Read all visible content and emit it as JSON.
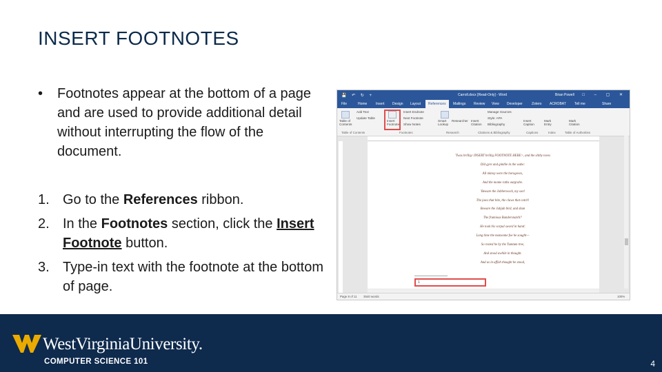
{
  "slide": {
    "title": "INSERT FOOTNOTES",
    "bullet": "Footnotes appear at the bottom of a page and are used to provide additional detail without interrupting the flow of the document.",
    "steps": [
      {
        "num": "1.",
        "pre": "Go to the ",
        "bold": "References",
        "post": " ribbon."
      },
      {
        "num": "2.",
        "pre": "In the ",
        "bold": "Footnotes",
        "mid": " section, click the ",
        "bold_underlined": "Insert Footnote",
        "post": " button."
      },
      {
        "num": "3.",
        "pre": "Type-in text with the footnote at the bottom of page."
      }
    ]
  },
  "footer": {
    "university": "WestVirginiaUniversity.",
    "course": "COMPUTER SCIENCE 101",
    "page_number": "4",
    "bg_color": "#0e2a4d",
    "logo_color": "#eaaa00"
  },
  "word": {
    "doc_title": "Carroll.docx [Read-Only] - Word",
    "user": "Brian Powell",
    "tabs": [
      "File",
      "Home",
      "Insert",
      "Design",
      "Layout",
      "References",
      "Mailings",
      "Review",
      "View",
      "Developer",
      "Zotero",
      "ACROBAT",
      "Tell me",
      "Share"
    ],
    "active_tab": "References",
    "ribbon_items": {
      "toc": "Table of Contents",
      "add_text": "Add Text",
      "update_table": "Update Table",
      "insert_footnote": "Insert Footnote",
      "insert_endnote": "Insert Endnote",
      "next_footnote": "Next Footnote",
      "show_notes": "Show Notes",
      "smart_lookup": "Smart Lookup",
      "researcher": "Researcher",
      "insert_citation": "Insert Citation",
      "manage_sources": "Manage Sources",
      "style": "Style: APA",
      "bibliography": "Bibliography",
      "insert_caption": "Insert Caption",
      "mark_entry": "Mark Entry",
      "mark_citation": "Mark Citation"
    },
    "groups": [
      "Table of Contents",
      "Footnotes",
      "Research",
      "Citations & Bibliography",
      "Captions",
      "Index",
      "Table of Authorities"
    ],
    "poem_lines": [
      "'Twas brillig<INSERT brillig FOOTNOTE HERE>, and the slithy toves",
      "Did gyre and gimble in the wabe:",
      "All mimsy were the borogoves,",
      "And the mome raths outgrabe.",
      "'Beware the Jabberwock, my son!",
      "The jaws that bite, the claws that catch!",
      "Beware the Jubjub bird, and shun",
      "The frumious Bandersnatch!'",
      "He took his vorpal sword in hand:",
      "Long time the manxome foe he sought—",
      "So rested he by the Tumtum tree,",
      "And stood awhile in thought.",
      "And as in uffish thought he stood,"
    ],
    "footnote_text": "1",
    "status": {
      "page": "Page 8 of 11",
      "words": "3540 words",
      "zoom": "100%"
    }
  }
}
